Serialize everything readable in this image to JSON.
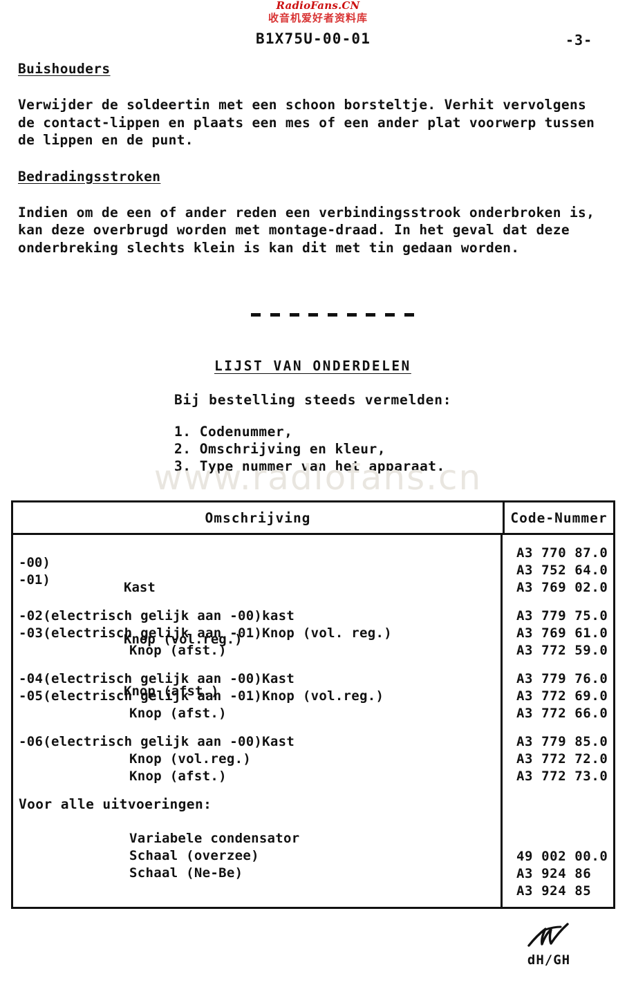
{
  "watermarks": {
    "top_latin": "RadioFans.CN",
    "top_cjk": "收音机爱好者资料库",
    "center": "www.radiofans.cn",
    "red_hex": "#cc1111"
  },
  "header": {
    "doc_code": "B1X75U-00-01",
    "page_number": "-3-"
  },
  "sections": [
    {
      "heading": "Buishouders",
      "body": "Verwijder de soldeertin met een schoon borsteltje. Verhit vervolgens\nde contact-lippen en plaats een mes of een ander plat voorwerp tussen\nde lippen en de punt."
    },
    {
      "heading": "Bedradingsstroken",
      "body": "Indien om de een of ander reden een verbindingsstrook onderbroken is,\nkan deze overbrugd worden met montage-draad. In het geval dat deze\nonderbreking slechts klein is kan dit met tin gedaan worden."
    }
  ],
  "divider": {
    "dash_count": 9
  },
  "parts_list": {
    "title": "LIJST VAN ONDERDELEN",
    "order_note": "Bij bestelling steeds vermelden:",
    "order_items": [
      "1. Codenummer,",
      "2. Omschrijving en kleur,",
      "3. Type nummer van het apparaat."
    ]
  },
  "table": {
    "columns": {
      "description": "Omschrijving",
      "code": "Code-Nummer"
    },
    "groups": [
      {
        "style": "brace",
        "brace_labels": [
          "-00)",
          "-01)"
        ],
        "items": [
          "Kast",
          "Knop (vol.reg.)",
          "Knop (afst.)"
        ],
        "codes": [
          "A3 770 87.0",
          "A3 752 64.0",
          "A3 769 02.0"
        ]
      },
      {
        "style": "prefixed",
        "rows": [
          {
            "lead": "-02(electrisch gelijk aan -00)",
            "text": "kast"
          },
          {
            "lead": "-03(electrisch gelijk aan -01)",
            "text": "Knop (vol. reg.)"
          },
          {
            "lead": "",
            "text": "Knop (afst.)"
          }
        ],
        "codes": [
          "A3 779 75.0",
          "A3 769 61.0",
          "A3 772 59.0"
        ]
      },
      {
        "style": "prefixed",
        "rows": [
          {
            "lead": "-04(electrisch gelijk aan -00)",
            "text": "Kast"
          },
          {
            "lead": "-05(electrisch gelijk aan -01)",
            "text": "Knop (vol.reg.)"
          },
          {
            "lead": "",
            "text": "Knop (afst.)"
          }
        ],
        "codes": [
          "A3 779 76.0",
          "A3 772 69.0",
          "A3 772 66.0"
        ]
      },
      {
        "style": "prefixed",
        "rows": [
          {
            "lead": "-06(electrisch gelijk aan -00)",
            "text": "Kast"
          },
          {
            "lead": "",
            "text": "Knop (vol.reg.)"
          },
          {
            "lead": "",
            "text": "Knop (afst.)"
          }
        ],
        "codes": [
          "A3 779 85.0",
          "A3 772 72.0",
          "A3 772 73.0"
        ]
      },
      {
        "style": "labeled",
        "label": "Voor alle uitvoeringen:",
        "items": [
          "Variabele condensator",
          "Schaal (overzee)",
          "Schaal (Ne-Be)"
        ],
        "codes": [
          "49 002 00.0",
          "A3 924 86",
          "A3 924 85"
        ]
      }
    ]
  },
  "footer": {
    "initials": "dH/GH"
  }
}
